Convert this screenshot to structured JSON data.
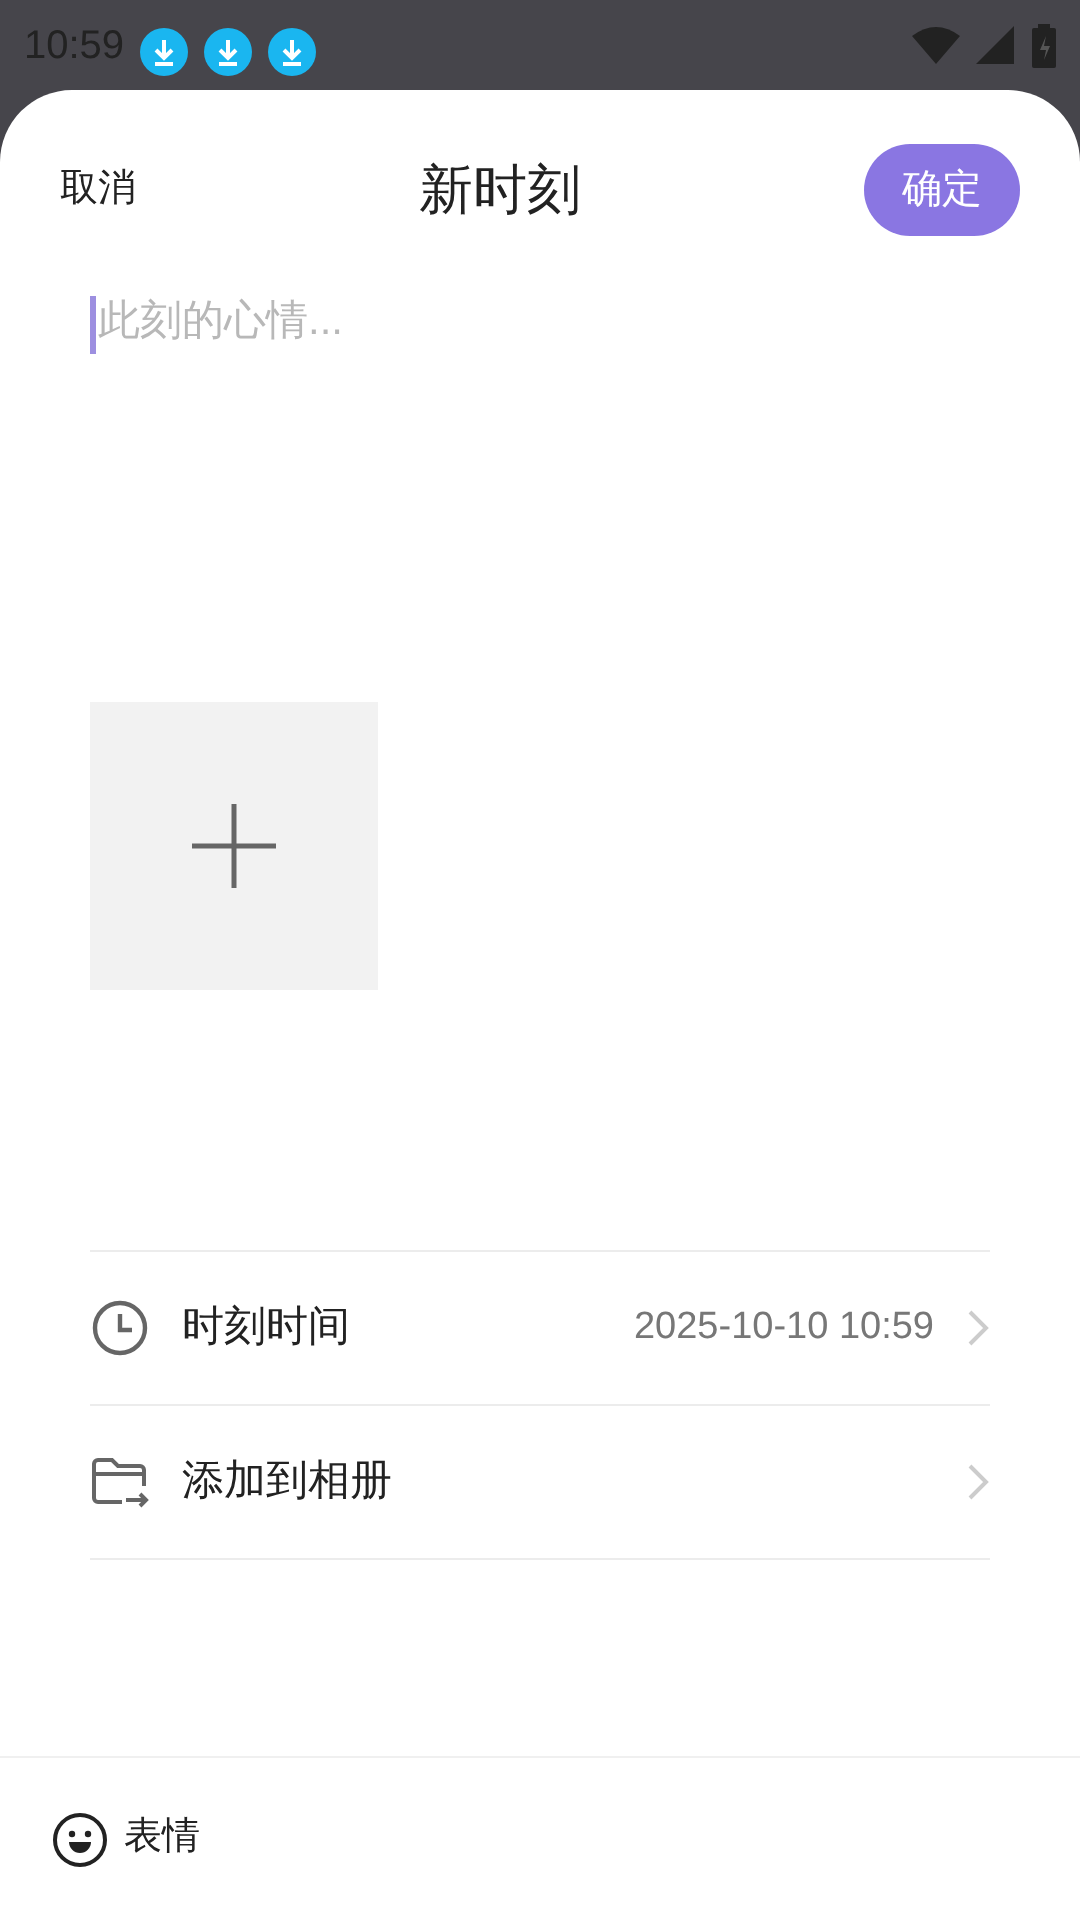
{
  "status_bar": {
    "time": "10:59",
    "notifications": [
      {
        "kind": "download"
      },
      {
        "kind": "download"
      },
      {
        "kind": "download"
      }
    ]
  },
  "header": {
    "cancel": "取消",
    "title": "新时刻",
    "confirm": "确定"
  },
  "editor": {
    "placeholder": "此刻的心情..."
  },
  "rows": [
    {
      "kind": "time",
      "label": "时刻时间",
      "value": "2025-10-10 10:59"
    },
    {
      "kind": "album",
      "label": "添加到相册"
    }
  ],
  "footer": {
    "label": "表情"
  }
}
